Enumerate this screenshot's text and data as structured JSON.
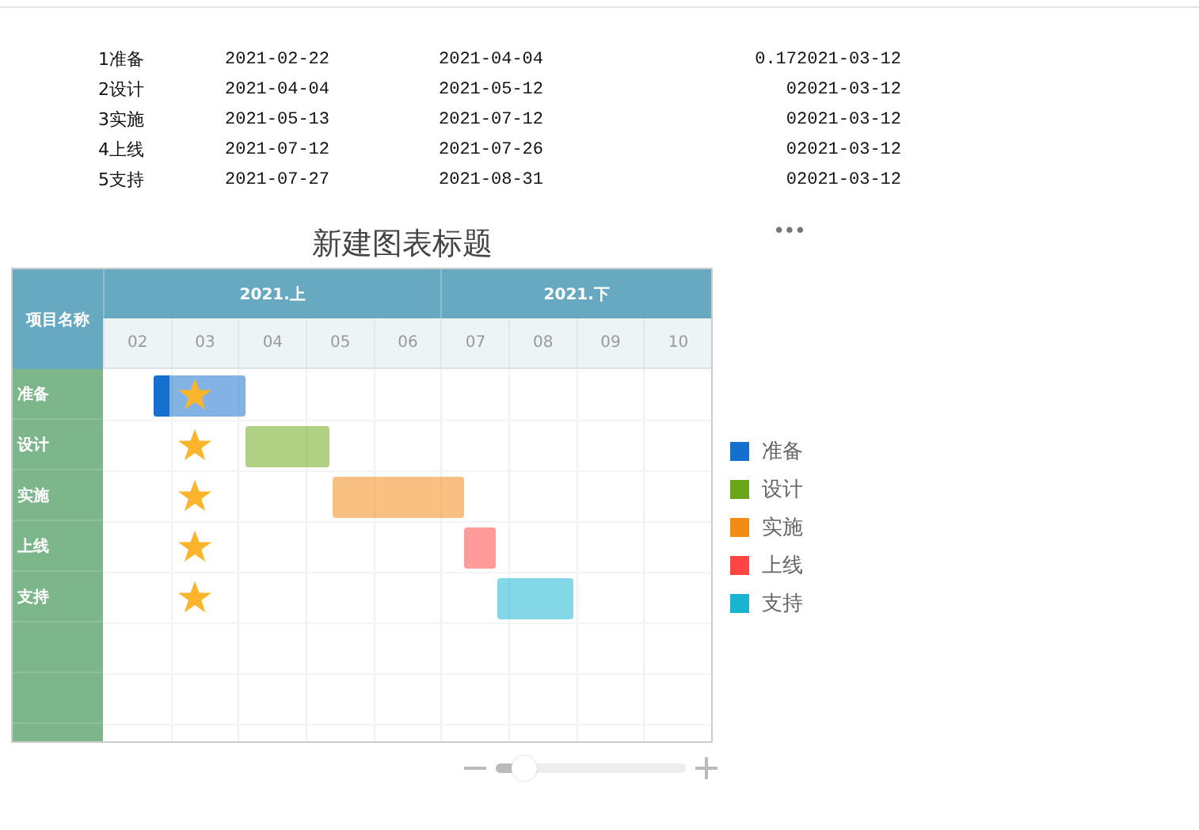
{
  "table": {
    "rows": [
      {
        "no": "1",
        "name": "准备",
        "start": "2021-02-22",
        "end": "2021-04-04",
        "progress": "0.17",
        "baseline": "2021-03-12"
      },
      {
        "no": "2",
        "name": "设计",
        "start": "2021-04-04",
        "end": "2021-05-12",
        "progress": "0",
        "baseline": "2021-03-12"
      },
      {
        "no": "3",
        "name": "实施",
        "start": "2021-05-13",
        "end": "2021-07-12",
        "progress": "0",
        "baseline": "2021-03-12"
      },
      {
        "no": "4",
        "name": "上线",
        "start": "2021-07-12",
        "end": "2021-07-26",
        "progress": "0",
        "baseline": "2021-03-12"
      },
      {
        "no": "5",
        "name": "支持",
        "start": "2021-07-27",
        "end": "2021-08-31",
        "progress": "0",
        "baseline": "2021-03-12"
      }
    ]
  },
  "chart": {
    "title": "新建图表标题",
    "menu": "•••",
    "name_header": "项目名称",
    "periods": [
      {
        "label": "2021.上",
        "months": [
          "02",
          "03",
          "04",
          "05",
          "06"
        ]
      },
      {
        "label": "2021.下",
        "months": [
          "07",
          "08",
          "09",
          "10"
        ]
      }
    ],
    "row_labels": [
      "准备",
      "设计",
      "实施",
      "上线",
      "支持"
    ],
    "legend": [
      {
        "label": "准备",
        "color": "#1470cc"
      },
      {
        "label": "设计",
        "color": "#6aa618"
      },
      {
        "label": "实施",
        "color": "#f48b12"
      },
      {
        "label": "上线",
        "color": "#ff4444"
      },
      {
        "label": "支持",
        "color": "#18b4d0"
      }
    ]
  },
  "zoom": {
    "level": 0.15
  }
}
